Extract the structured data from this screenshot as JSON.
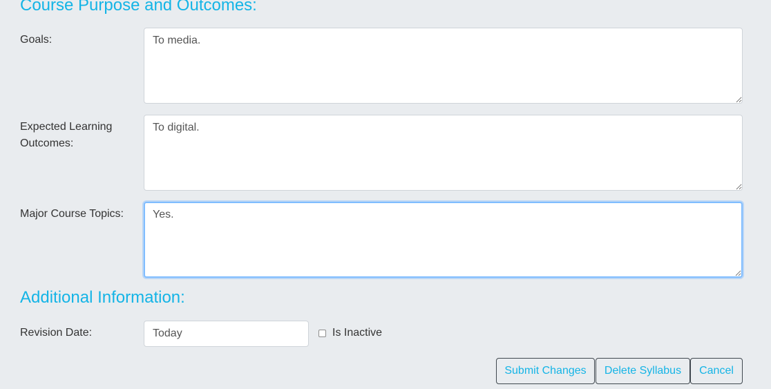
{
  "sections": {
    "purpose_heading": "Course Purpose and Outcomes:",
    "additional_heading": "Additional Information:"
  },
  "fields": {
    "goals": {
      "label": "Goals:",
      "value": "To media."
    },
    "outcomes": {
      "label": "Expected Learning Outcomes:",
      "value": "To digital."
    },
    "topics": {
      "label": "Major Course Topics:",
      "value": "Yes.",
      "focused": true
    },
    "revision_date": {
      "label": "Revision Date:",
      "value": "Today"
    },
    "inactive": {
      "label": "Is Inactive",
      "checked": false
    }
  },
  "buttons": {
    "submit": "Submit Changes",
    "delete": "Delete Syllabus",
    "cancel": "Cancel"
  },
  "colors": {
    "accent": "#14b4e6",
    "background": "#e9ecef",
    "focus": "#80bdff"
  }
}
